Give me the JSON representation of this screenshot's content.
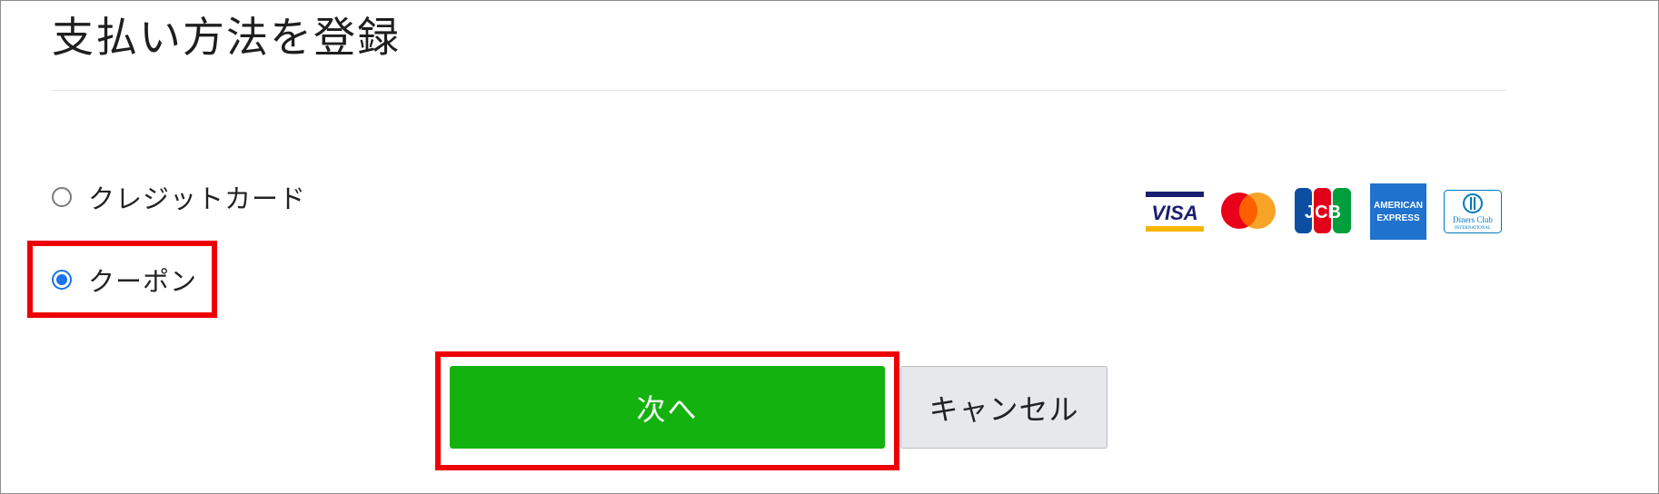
{
  "page": {
    "title": "支払い方法を登録"
  },
  "payment_options": [
    {
      "label": "クレジットカード",
      "selected": false
    },
    {
      "label": "クーポン",
      "selected": true
    }
  ],
  "card_brands": [
    {
      "name": "VISA",
      "icon": "visa-logo-icon",
      "text": "VISA"
    },
    {
      "name": "Mastercard",
      "icon": "mastercard-logo-icon"
    },
    {
      "name": "JCB",
      "icon": "jcb-logo-icon",
      "text": "JCB"
    },
    {
      "name": "American Express",
      "icon": "amex-logo-icon",
      "text_line1": "AMERICAN",
      "text_line2": "EXPRESS"
    },
    {
      "name": "Diners Club",
      "icon": "diners-club-logo-icon",
      "text_line1": "Diners Club",
      "text_line2": "INTERNATIONAL"
    }
  ],
  "buttons": {
    "next_label": "次へ",
    "cancel_label": "キャンセル"
  },
  "colors": {
    "primary_button": "#13b20f",
    "radio_selected": "#1a73e8",
    "highlight_box": "#ee0000",
    "cancel_button_bg": "#e6e8ec"
  }
}
